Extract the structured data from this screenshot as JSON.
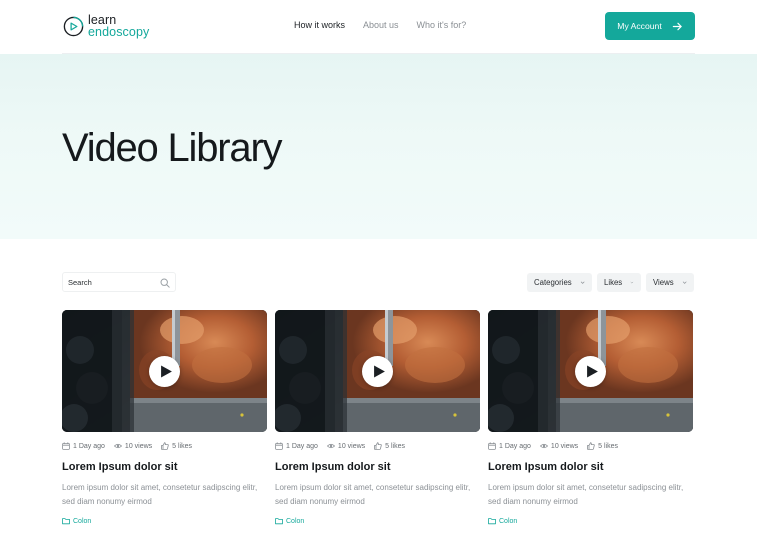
{
  "header": {
    "logo_line1": "learn",
    "logo_line2": "endoscopy",
    "nav": [
      {
        "label": "How it works",
        "active": true
      },
      {
        "label": "About us",
        "active": false
      },
      {
        "label": "Who it's for?",
        "active": false
      }
    ],
    "account_label": "My Account",
    "account_icon": "arrow-right-icon"
  },
  "hero": {
    "title": "Video Library"
  },
  "toolbar": {
    "search_placeholder": "Search",
    "search_icon": "search-icon",
    "filters": [
      {
        "label": "Categories",
        "icon": "chevron-down-icon"
      },
      {
        "label": "Likes",
        "icon": "chevron-down-icon"
      },
      {
        "label": "Views",
        "icon": "chevron-down-icon"
      }
    ]
  },
  "cards": [
    {
      "date": "1 Day ago",
      "views": "10 views",
      "likes": "5 likes",
      "title": "Lorem Ipsum dolor sit",
      "description": "Lorem ipsum dolor sit amet, consetetur sadipscing elitr, sed diam nonumy eirmod",
      "category": "Colon"
    },
    {
      "date": "1 Day ago",
      "views": "10 views",
      "likes": "5 likes",
      "title": "Lorem Ipsum dolor sit",
      "description": "Lorem ipsum dolor sit amet, consetetur sadipscing elitr, sed diam nonumy eirmod",
      "category": "Colon"
    },
    {
      "date": "1 Day ago",
      "views": "10 views",
      "likes": "5 likes",
      "title": "Lorem Ipsum dolor sit",
      "description": "Lorem ipsum dolor sit amet, consetetur sadipscing elitr, sed diam nonumy eirmod",
      "category": "Colon"
    }
  ],
  "colors": {
    "accent": "#14a89b",
    "text_dark": "#15191c",
    "text_muted": "#8c9196",
    "hero_bg": "#e6f5f3"
  }
}
